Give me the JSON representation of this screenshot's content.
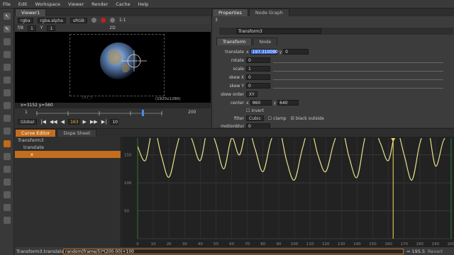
{
  "menu": [
    "File",
    "Edit",
    "Workspace",
    "Viewer",
    "Render",
    "Cache",
    "Help"
  ],
  "viewer": {
    "tab": "Viewer1",
    "channels": "rgba",
    "alpha": "rgba.alpha",
    "colorspace": "sRGB",
    "frame_label": "f/8",
    "frame_value": "1",
    "gain_label": "Y",
    "gain_value": "1",
    "zoom": "1:1",
    "mode": "2D",
    "coords": "x=3152 y=560",
    "format": "(1920x1280)",
    "bbox_label": "192_5",
    "range_start": "1",
    "range_end": "200",
    "ticks": [
      "1",
      "50",
      "100",
      "150",
      "200"
    ],
    "current_frame": "163",
    "step": "10",
    "playback_mode": "Global"
  },
  "properties": {
    "tabs": [
      "Properties",
      "Node Graph"
    ],
    "count": "3",
    "node_name": "Transform3",
    "subtabs": [
      "Transform",
      "Node"
    ],
    "rows": {
      "translate": {
        "label": "translate",
        "x_label": "x",
        "x": "197.310090",
        "y_label": "y",
        "y": "0"
      },
      "rotate": {
        "label": "rotate",
        "value": "0"
      },
      "scale": {
        "label": "scale",
        "value": "1"
      },
      "skewx": {
        "label": "skew X",
        "value": "0"
      },
      "skewy": {
        "label": "skew Y",
        "value": "0"
      },
      "skeworder": {
        "label": "skew order",
        "value": "XY"
      },
      "center": {
        "label": "center",
        "x_label": "x",
        "x": "960",
        "y_label": "y",
        "y": "640"
      },
      "invert": {
        "label": "invert"
      },
      "filter": {
        "label": "filter",
        "value": "Cubic",
        "clamp": "clamp",
        "black_outside": "black outside"
      },
      "motionblur": {
        "label": "motionblur",
        "value": "0"
      }
    }
  },
  "curve_editor": {
    "tabs": [
      "Curve Editor",
      "Dope Sheet"
    ],
    "tree": [
      "Transform3",
      "translate",
      "x"
    ],
    "y_labels": [
      "150",
      "100",
      "50"
    ],
    "x_labels": [
      "0",
      "10",
      "20",
      "30",
      "40",
      "50",
      "60",
      "70",
      "80",
      "90",
      "100",
      "110",
      "120",
      "130",
      "140",
      "150",
      "160",
      "170",
      "180",
      "190",
      "200"
    ],
    "curve_name": "Transform3.translate.x",
    "expression": "random(frame/5)*(200-00)+100",
    "value": "= 195.5",
    "revert": "Revert"
  },
  "colors": {
    "accent_orange": "#c36e1e",
    "curve_yellow": "#e6e08a",
    "playhead_yellow": "#f0e060",
    "translate_highlight": "#3a6fd8"
  },
  "chart_data": {
    "type": "line",
    "x_values": [
      0,
      5,
      10,
      15,
      20,
      25,
      30,
      35,
      40,
      45,
      50,
      55,
      60,
      65,
      70,
      75,
      80,
      85,
      90,
      95,
      100,
      105,
      110,
      115,
      120,
      125,
      130,
      135,
      140,
      145,
      150,
      155,
      160,
      165,
      170,
      175,
      180,
      185,
      190,
      195,
      200
    ],
    "y_values": [
      165,
      140,
      200,
      150,
      110,
      165,
      210,
      175,
      140,
      200,
      170,
      125,
      180,
      150,
      200,
      160,
      120,
      175,
      200,
      140,
      105,
      160,
      200,
      150,
      120,
      170,
      200,
      145,
      110,
      180,
      200,
      170,
      140,
      195,
      150,
      105,
      170,
      200,
      130,
      175,
      195
    ],
    "ylim": [
      0,
      180
    ],
    "xlim": [
      0,
      200
    ],
    "playhead": 163
  }
}
